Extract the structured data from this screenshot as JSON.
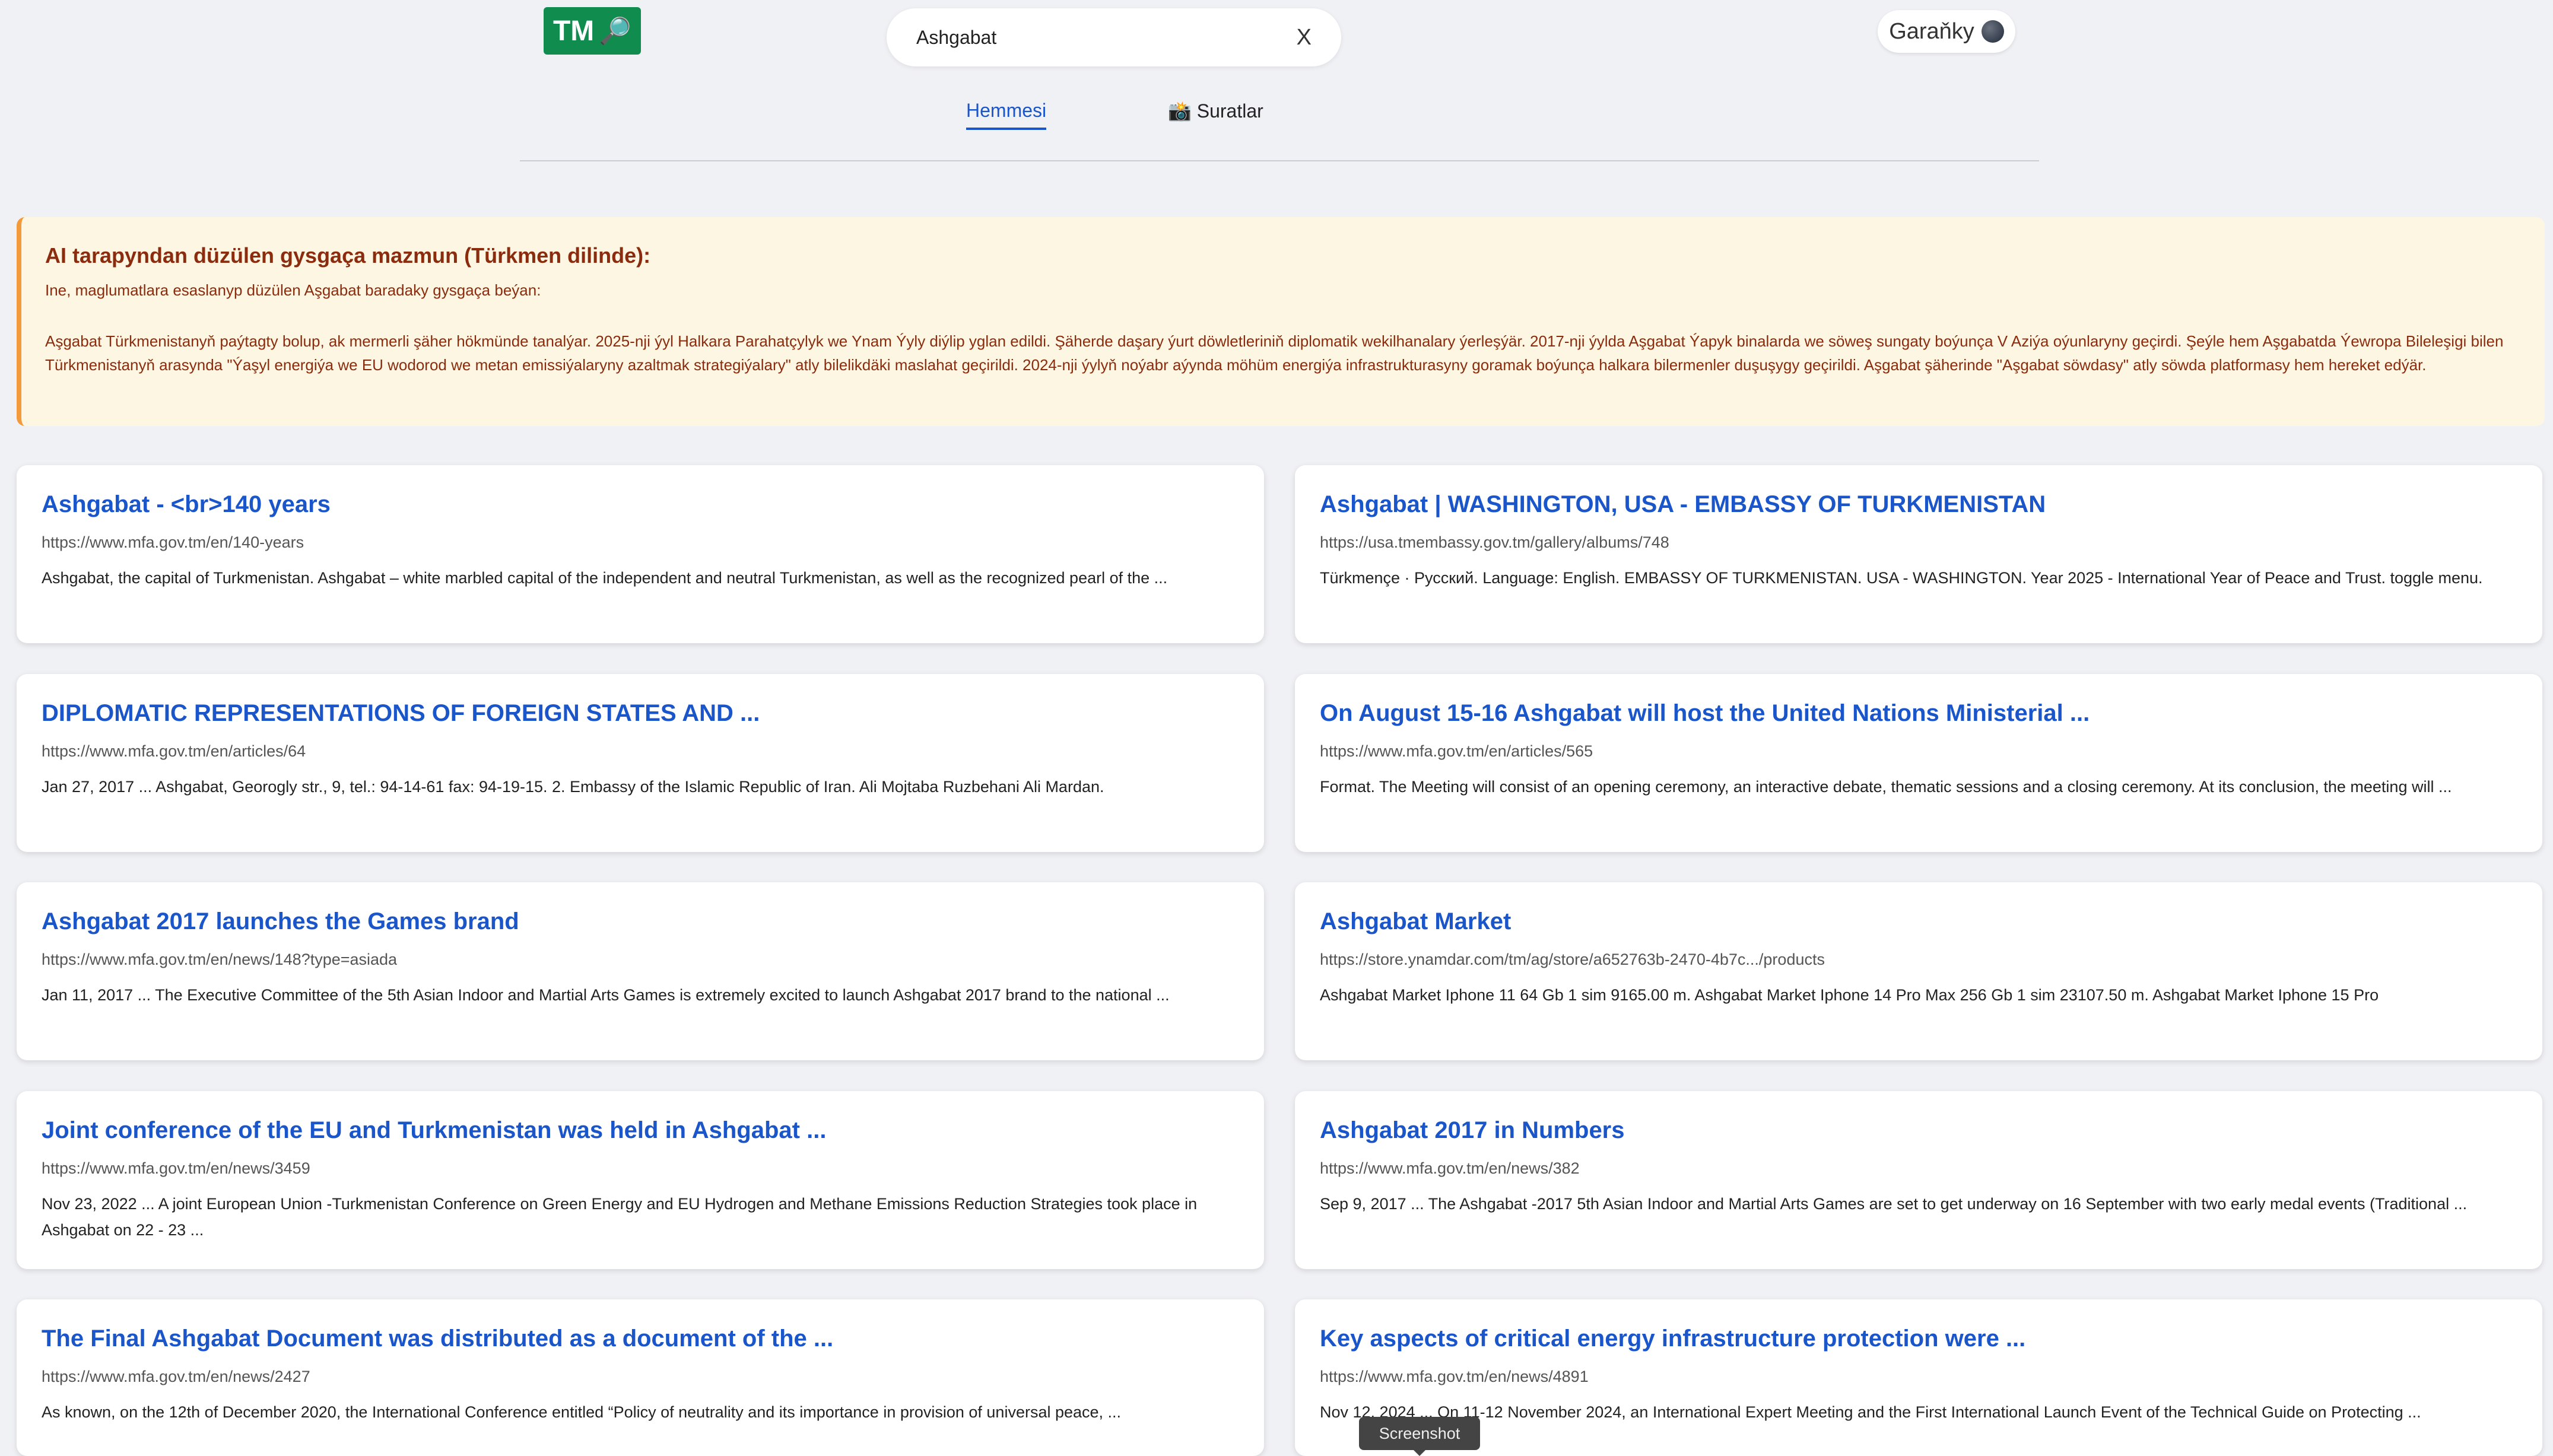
{
  "logo": {
    "text": "TM",
    "icon": "magnifier-icon"
  },
  "search": {
    "value": "Ashgabat",
    "clear_label": "X"
  },
  "theme_toggle": {
    "label": "Garaňky",
    "icon": "moon-icon"
  },
  "tabs": [
    {
      "label": "Hemmesi",
      "active": true
    },
    {
      "label": "📸 Suratlar",
      "active": false
    }
  ],
  "ai_summary": {
    "title": "AI tarapyndan düzülen gysgaça mazmun (Türkmen dilinde):",
    "intro": "Ine, maglumatlara esaslanyp düzülen Aşgabat baradaky gysgaça beýan:",
    "body": "Aşgabat Türkmenistanyň paýtagty bolup, ak mermerli şäher hökmünde tanalýar. 2025-nji ýyl Halkara Parahatçylyk we Ynam Ýyly diýlip yglan edildi. Şäherde daşary ýurt döwletleriniň diplomatik wekilhanalary ýerleşýär. 2017-nji ýylda Aşgabat Ýapyk binalarda we söweş sungaty boýunça V Aziýa oýunlaryny geçirdi. Şeýle hem Aşgabatda Ýewropa Bileleşigi bilen Türkmenistanyň arasynda \"Ýaşyl energiýa we EU wodorod we metan emissiýalaryny azaltmak strategiýalary\" atly bilelikdäki maslahat geçirildi. 2024-nji ýylyň noýabr aýynda möhüm energiýa infrastrukturasyny goramak boýunça halkara bilermenler duşuşygy geçirildi. Aşgabat şäherinde \"Aşgabat söwdasy\" atly söwda platformasy hem hereket edýär."
  },
  "results": [
    {
      "title": "Ashgabat - <br>140 years",
      "url": "https://www.mfa.gov.tm/en/140-years",
      "snippet": "Ashgabat, the capital of Turkmenistan. Ashgabat – white marbled capital of the independent and neutral Turkmenistan, as well as the recognized pearl of the ..."
    },
    {
      "title": "Ashgabat | WASHINGTON, USA - EMBASSY OF TURKMENISTAN",
      "url": "https://usa.tmembassy.gov.tm/gallery/albums/748",
      "snippet": "Türkmençe · Русский. Language: English. EMBASSY OF TURKMENISTAN. USA - WASHINGTON. Year 2025 - International Year of Peace and Trust. toggle menu."
    },
    {
      "title": "DIPLOMATIC REPRESENTATIONS OF FOREIGN STATES AND ...",
      "url": "https://www.mfa.gov.tm/en/articles/64",
      "snippet": "Jan 27, 2017 ... Ashgabat, Georogly str., 9, tel.: 94-14-61 fax: 94-19-15. 2. Embassy of the Islamic Republic of Iran. Ali Mojtaba Ruzbehani Ali Mardan."
    },
    {
      "title": "On August 15-16 Ashgabat will host the United Nations Ministerial ...",
      "url": "https://www.mfa.gov.tm/en/articles/565",
      "snippet": "Format. The Meeting will consist of an opening ceremony, an interactive debate, thematic sessions and a closing ceremony. At its conclusion, the meeting will ..."
    },
    {
      "title": "Ashgabat 2017 launches the Games brand",
      "url": "https://www.mfa.gov.tm/en/news/148?type=asiada",
      "snippet": "Jan 11, 2017 ... The Executive Committee of the 5th Asian Indoor and Martial Arts Games is extremely excited to launch Ashgabat 2017 brand to the national ..."
    },
    {
      "title": "Ashgabat Market",
      "url": "https://store.ynamdar.com/tm/ag/store/a652763b-2470-4b7c.../products",
      "snippet": "Ashgabat Market Iphone 11 64 Gb 1 sim 9165.00 m. Ashgabat Market Iphone 14 Pro Max 256 Gb 1 sim 23107.50 m. Ashgabat Market Iphone 15 Pro"
    },
    {
      "title": "Joint conference of the EU and Turkmenistan was held in Ashgabat ...",
      "url": "https://www.mfa.gov.tm/en/news/3459",
      "snippet": "Nov 23, 2022 ... A joint European Union -Turkmenistan Conference on Green Energy and EU Hydrogen and Methane Emissions Reduction Strategies took place in Ashgabat on 22 - 23 ..."
    },
    {
      "title": "Ashgabat 2017 in Numbers",
      "url": "https://www.mfa.gov.tm/en/news/382",
      "snippet": "Sep 9, 2017 ... The Ashgabat -2017 5th Asian Indoor and Martial Arts Games are set to get underway on 16 September with two early medal events (Traditional ..."
    },
    {
      "title": "The Final Ashgabat Document was distributed as a document of the ...",
      "url": "https://www.mfa.gov.tm/en/news/2427",
      "snippet": "As known, on the 12th of December 2020, the International Conference entitled “Policy of neutrality and its importance in provision of universal peace, ..."
    },
    {
      "title": "Key aspects of critical energy infrastructure protection were ...",
      "url": "https://www.mfa.gov.tm/en/news/4891",
      "snippet": "Nov 12, 2024 ... On 11-12 November 2024, an International Expert Meeting and the First International Launch Event of the Technical Guide on Protecting ..."
    }
  ],
  "tooltip": {
    "text": "Screenshot"
  },
  "colors": {
    "link": "#1a56c9",
    "logo_bg": "#118c4f",
    "ai_bg": "#fdf6e3",
    "ai_border": "#f29a3c",
    "ai_text": "#8a2c0d"
  }
}
